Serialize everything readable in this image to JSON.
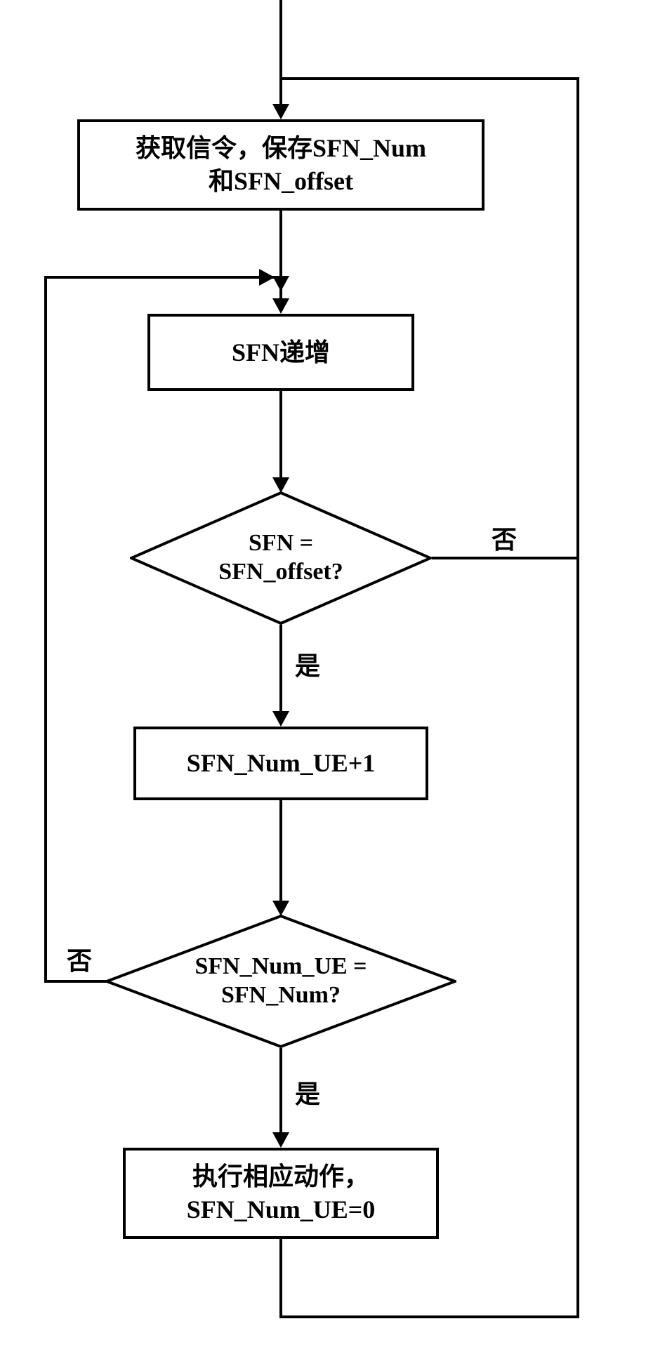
{
  "flowchart": {
    "box1": "获取信令，保存SFN_Num\n和SFN_offset",
    "box2": "SFN递增",
    "decision1": "SFN =\nSFN_offset?",
    "box3": "SFN_Num_UE+1",
    "decision2": "SFN_Num_UE =\nSFN_Num?",
    "box4": "执行相应动作，\nSFN_Num_UE=0",
    "yes": "是",
    "no": "否"
  }
}
